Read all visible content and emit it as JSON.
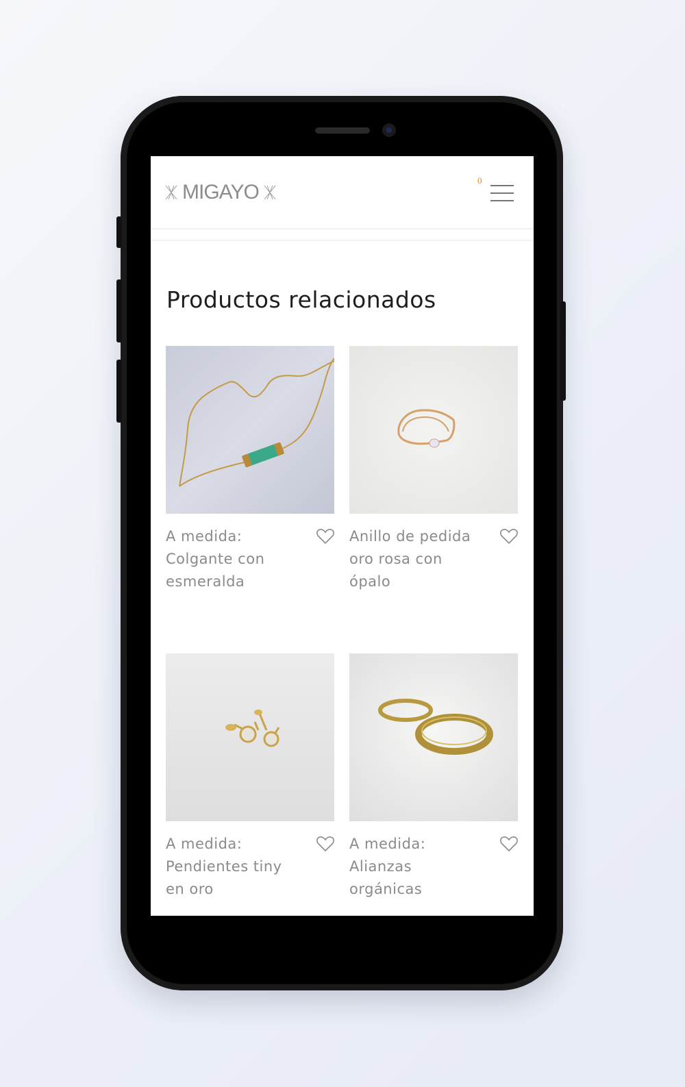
{
  "header": {
    "logo_text": "MIGAYO",
    "cart_count": "0",
    "menu_icon": "hamburger-menu-icon"
  },
  "section": {
    "title": "Productos relacionados"
  },
  "products": [
    {
      "name": "A medida: Colgante con esmeralda",
      "wishlist_icon": "heart-icon"
    },
    {
      "name": "Anillo de pedida oro rosa con ópalo",
      "wishlist_icon": "heart-icon"
    },
    {
      "name": "A medida: Pendientes tiny en oro",
      "wishlist_icon": "heart-icon"
    },
    {
      "name": "A medida: Alianzas orgánicas",
      "wishlist_icon": "heart-icon"
    }
  ],
  "colors": {
    "cart_badge": "#e08a3c",
    "title": "#1e1e1e",
    "product_text": "#8a8a8a"
  }
}
